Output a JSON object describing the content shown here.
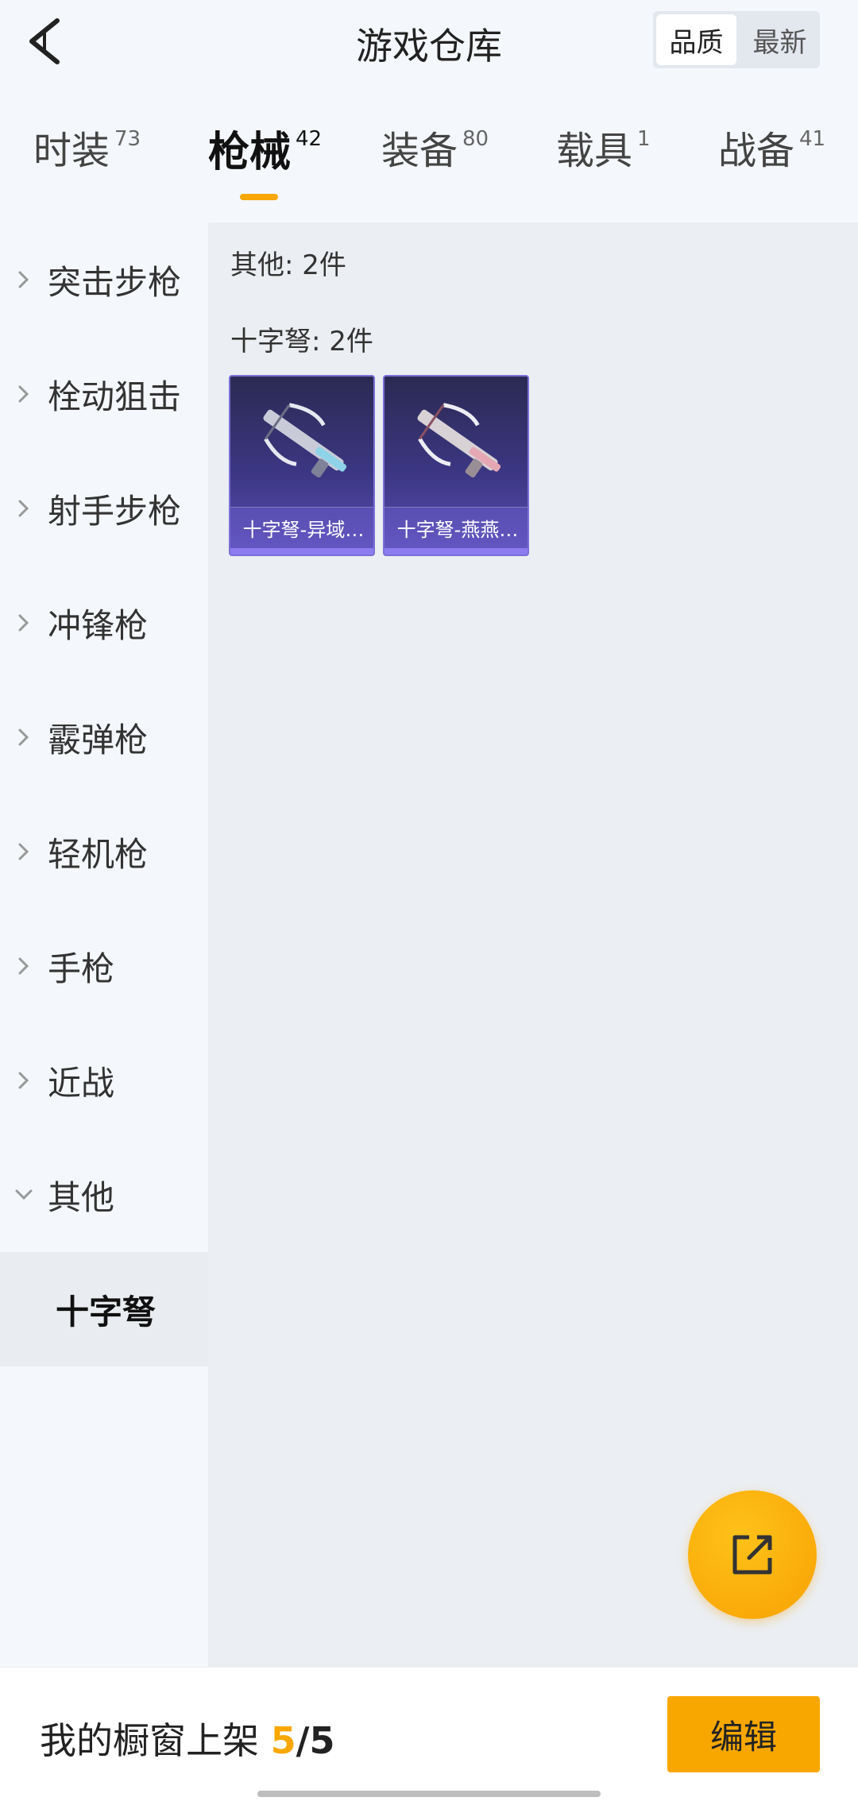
{
  "header": {
    "title": "游戏仓库",
    "sort_options": [
      "品质",
      "最新"
    ],
    "sort_selected": "品质"
  },
  "tabs": [
    {
      "label": "时装",
      "count": "73"
    },
    {
      "label": "枪械",
      "count": "42",
      "active": true
    },
    {
      "label": "装备",
      "count": "80"
    },
    {
      "label": "载具",
      "count": "1"
    },
    {
      "label": "战备",
      "count": "41"
    }
  ],
  "sidebar": {
    "items": [
      {
        "label": "突击步枪"
      },
      {
        "label": "栓动狙击"
      },
      {
        "label": "射手步枪"
      },
      {
        "label": "冲锋枪"
      },
      {
        "label": "霰弹枪"
      },
      {
        "label": "轻机枪"
      },
      {
        "label": "手枪"
      },
      {
        "label": "近战"
      },
      {
        "label": "其他",
        "expanded": true
      }
    ],
    "sub_item": "十字弩"
  },
  "content": {
    "group_total": "其他: 2件",
    "subgroup": "十字弩: 2件",
    "items": [
      {
        "name": "十字弩-异域…"
      },
      {
        "name": "十字弩-燕燕…"
      }
    ]
  },
  "bottom": {
    "showcase_label": "我的橱窗上架",
    "showcase_count": "5",
    "showcase_sep": "/",
    "showcase_total": "5",
    "edit_label": "编辑"
  },
  "colors": {
    "accent": "#f7a700",
    "card_bg": "#3c3784",
    "page_bg": "#f4f7fb",
    "content_bg": "#ebeef2"
  }
}
